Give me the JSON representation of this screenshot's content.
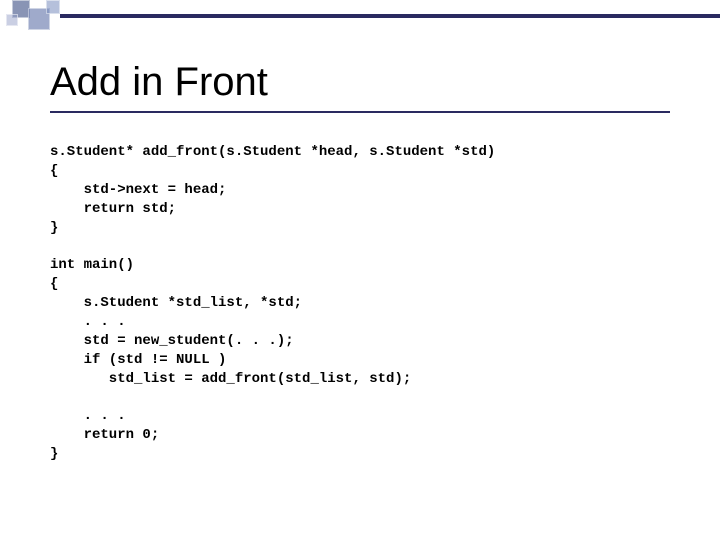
{
  "title": "Add in Front",
  "code_lines": [
    "s.Student* add_front(s.Student *head, s.Student *std)",
    "{",
    "    std->next = head;",
    "    return std;",
    "}",
    "",
    "int main()",
    "{",
    "    s.Student *std_list, *std;",
    "    . . .",
    "    std = new_student(. . .);",
    "    if (std != NULL )",
    "       std_list = add_front(std_list, std);",
    "",
    "    . . .",
    "    return 0;",
    "}"
  ]
}
